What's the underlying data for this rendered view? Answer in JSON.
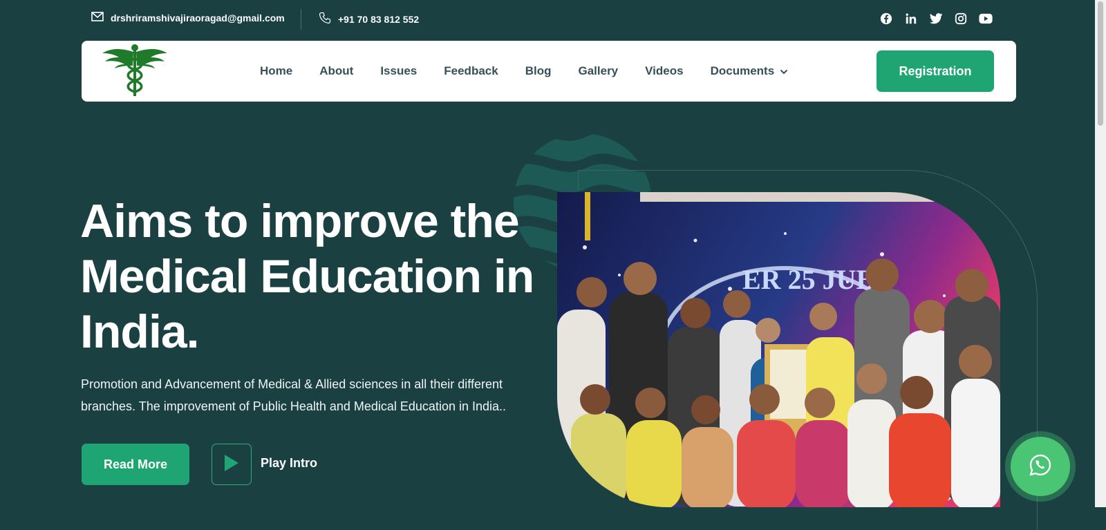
{
  "topbar": {
    "email": "drshriramshivajiraoragad@gmail.com",
    "phone": "+91 70 83 812 552",
    "socials": [
      "facebook-icon",
      "linkedin-icon",
      "twitter-icon",
      "instagram-icon",
      "youtube-icon"
    ]
  },
  "nav": {
    "items": [
      "Home",
      "About",
      "Issues",
      "Feedback",
      "Blog",
      "Gallery",
      "Videos",
      "Documents"
    ],
    "registration": "Registration"
  },
  "hero": {
    "title": "Aims to improve the Medical Education in India.",
    "description": "Promotion and Advancement of Medical & Allied sciences in all their different branches. The improvement of Public Health and Medical Education in India..",
    "read_more": "Read More",
    "play_intro": "Play Intro",
    "banner_text": "ER 25 JUBI"
  },
  "colors": {
    "background": "#1a4042",
    "accent": "#1fa574",
    "nav_text": "#35505a",
    "whatsapp": "#49c574"
  }
}
